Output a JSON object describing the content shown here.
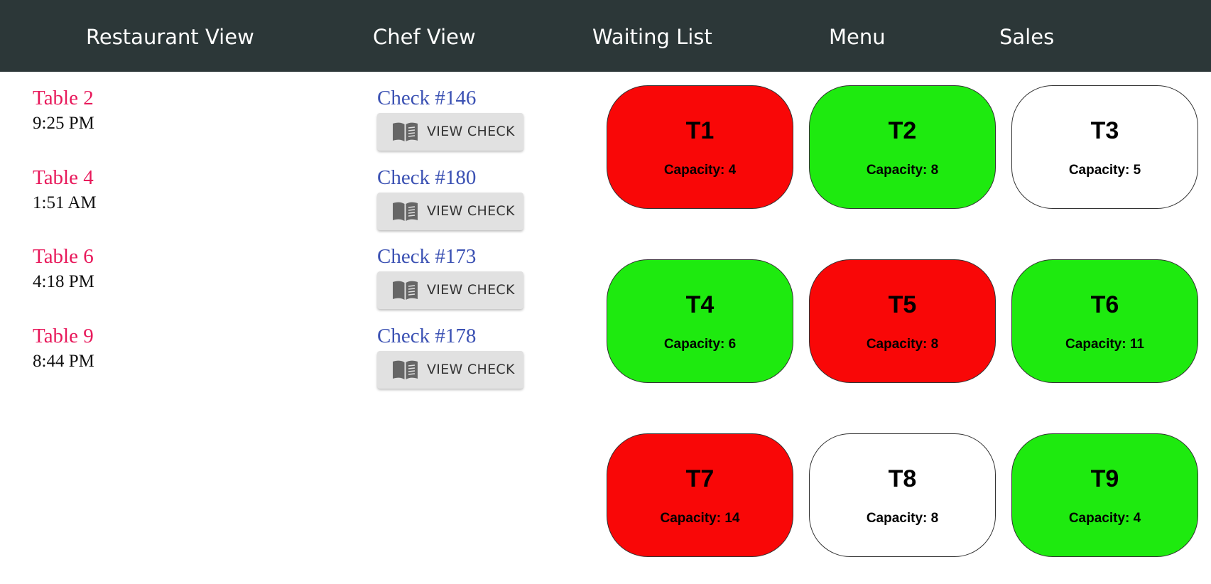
{
  "nav": {
    "items": [
      "Restaurant View",
      "Chef View",
      "Waiting List",
      "Menu",
      "Sales"
    ]
  },
  "occupied": [
    {
      "table": "Table 2",
      "time": "9:25 PM",
      "check": "Check #146",
      "button": "VIEW CHECK"
    },
    {
      "table": "Table 4",
      "time": "1:51 AM",
      "check": "Check #180",
      "button": "VIEW CHECK"
    },
    {
      "table": "Table 6",
      "time": "4:18 PM",
      "check": "Check #173",
      "button": "VIEW CHECK"
    },
    {
      "table": "Table 9",
      "time": "8:44 PM",
      "check": "Check #178",
      "button": "VIEW CHECK"
    }
  ],
  "tables": [
    {
      "name": "T1",
      "capacity": "Capacity: 4",
      "color": "#f90707"
    },
    {
      "name": "T2",
      "capacity": "Capacity: 8",
      "color": "#1eea0f"
    },
    {
      "name": "T3",
      "capacity": "Capacity: 5",
      "color": "#ffffff"
    },
    {
      "name": "T4",
      "capacity": "Capacity: 6",
      "color": "#1eea0f"
    },
    {
      "name": "T5",
      "capacity": "Capacity: 8",
      "color": "#f90707"
    },
    {
      "name": "T6",
      "capacity": "Capacity: 11",
      "color": "#1eea0f"
    },
    {
      "name": "T7",
      "capacity": "Capacity: 14",
      "color": "#f90707"
    },
    {
      "name": "T8",
      "capacity": "Capacity: 8",
      "color": "#ffffff"
    },
    {
      "name": "T9",
      "capacity": "Capacity: 4",
      "color": "#1eea0f"
    }
  ],
  "icons": {
    "view_check": "book-icon"
  },
  "colors": {
    "navbar": "#2c3738",
    "table_label": "#e8195b",
    "check_label": "#3b51b3",
    "occupied": "#f90707",
    "available": "#1eea0f",
    "empty": "#ffffff"
  }
}
